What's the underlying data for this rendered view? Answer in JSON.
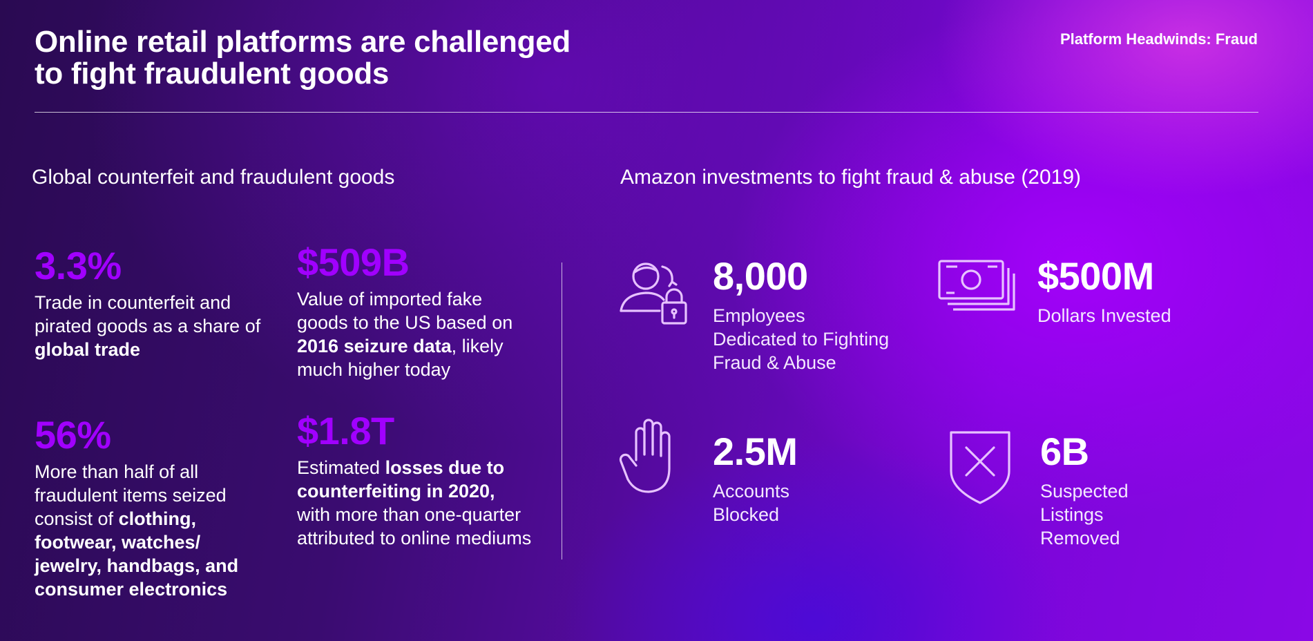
{
  "header": {
    "title_line1": "Online retail platforms are challenged",
    "title_line2": "to fight fraudulent goods",
    "tagline": "Platform Headwinds: Fraud"
  },
  "left": {
    "heading": "Global counterfeit and fraudulent goods",
    "stats": [
      {
        "value": "3.3%",
        "text1": "Trade in counterfeit and pirated goods as a share of ",
        "bold1": "global trade",
        "text2": "",
        "bold2": "",
        "text3": ""
      },
      {
        "value": "$509B",
        "text1": "Value of imported fake goods to the US based on  ",
        "bold1": "2016 seizure data",
        "text2": ", likely much higher today",
        "bold2": "",
        "text3": ""
      },
      {
        "value": "56%",
        "text1": "More than half of all fraudulent items seized consist of ",
        "bold1": "clothing, footwear, watches/ jewelry, handbags, and consumer electronics",
        "text2": "",
        "bold2": "",
        "text3": ""
      },
      {
        "value": "$1.8T",
        "text1": "Estimated ",
        "bold1": "losses due to counterfeiting in 2020,",
        "text2": " with more than one-quarter attributed to online mediums",
        "bold2": "",
        "text3": ""
      }
    ]
  },
  "right": {
    "heading": "Amazon investments to fight fraud & abuse (2019)",
    "metrics": [
      {
        "value": "8,000",
        "label_lines": [
          "Employees",
          "Dedicated to Fighting",
          "Fraud & Abuse"
        ],
        "icon": "person-lock-icon"
      },
      {
        "value": "$500M",
        "label_lines": [
          "Dollars Invested"
        ],
        "icon": "money-stack-icon"
      },
      {
        "value": "2.5M",
        "label_lines": [
          "Accounts",
          "Blocked"
        ],
        "icon": "hand-stop-icon"
      },
      {
        "value": "6B",
        "label_lines": [
          "Suspected",
          "Listings",
          "Removed"
        ],
        "icon": "shield-x-icon"
      }
    ]
  },
  "colors": {
    "accent": "#a100ff",
    "text": "#ffffff"
  }
}
